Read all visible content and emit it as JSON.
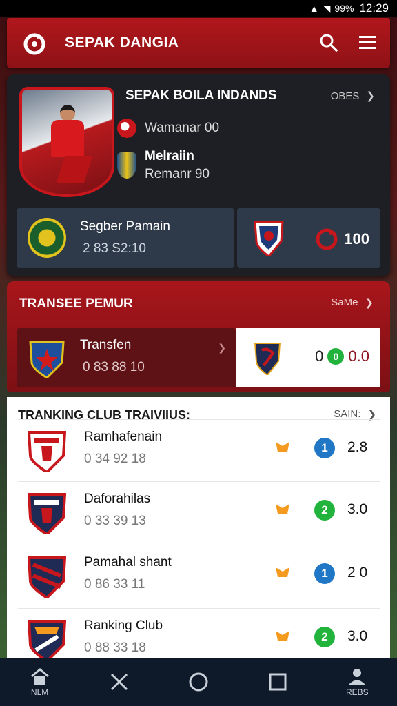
{
  "status": {
    "battery": "99%",
    "time": "12:29"
  },
  "header": {
    "title": "SEPAK DANGIA"
  },
  "featured": {
    "title": "SEPAK BOILA INDANDS",
    "see_more": "OBES",
    "line1": "Wamanar 00",
    "line2_title": "Melraiin",
    "line2_sub": "Remanr 90",
    "stat_left_name": "Segber Pamain",
    "stat_left_num": "2 83 S2:10",
    "stat_right_score": "100"
  },
  "transfer": {
    "title": "TRANSEE PEMUR",
    "see_more": "SaMe",
    "left_name": "Transfen",
    "left_num": "0 83 88 10",
    "right_score_a": "0",
    "right_dot": "0",
    "right_score_b": "0.0"
  },
  "ranking": {
    "title": "TRANKING CLUB TRAIVIIUS:",
    "see_more": "SAIN:",
    "rows": [
      {
        "name": "Ramhafenain",
        "num": "0 34 92 18",
        "rank": "1",
        "rank_color": "#1f77c6",
        "value": "2.8"
      },
      {
        "name": "Daforahilas",
        "num": "0 33 39 13",
        "rank": "2",
        "rank_color": "#22b33d",
        "value": "3.0"
      },
      {
        "name": "Pamahal shant",
        "num": "0 86 33 11",
        "rank": "1",
        "rank_color": "#1f77c6",
        "value": "2 0"
      },
      {
        "name": "Ranking Club",
        "num": "0 88 33 18",
        "rank": "2",
        "rank_color": "#22b33d",
        "value": "3.0"
      }
    ]
  },
  "nav": {
    "home_label": "NLM",
    "profile_label": "REBS"
  }
}
